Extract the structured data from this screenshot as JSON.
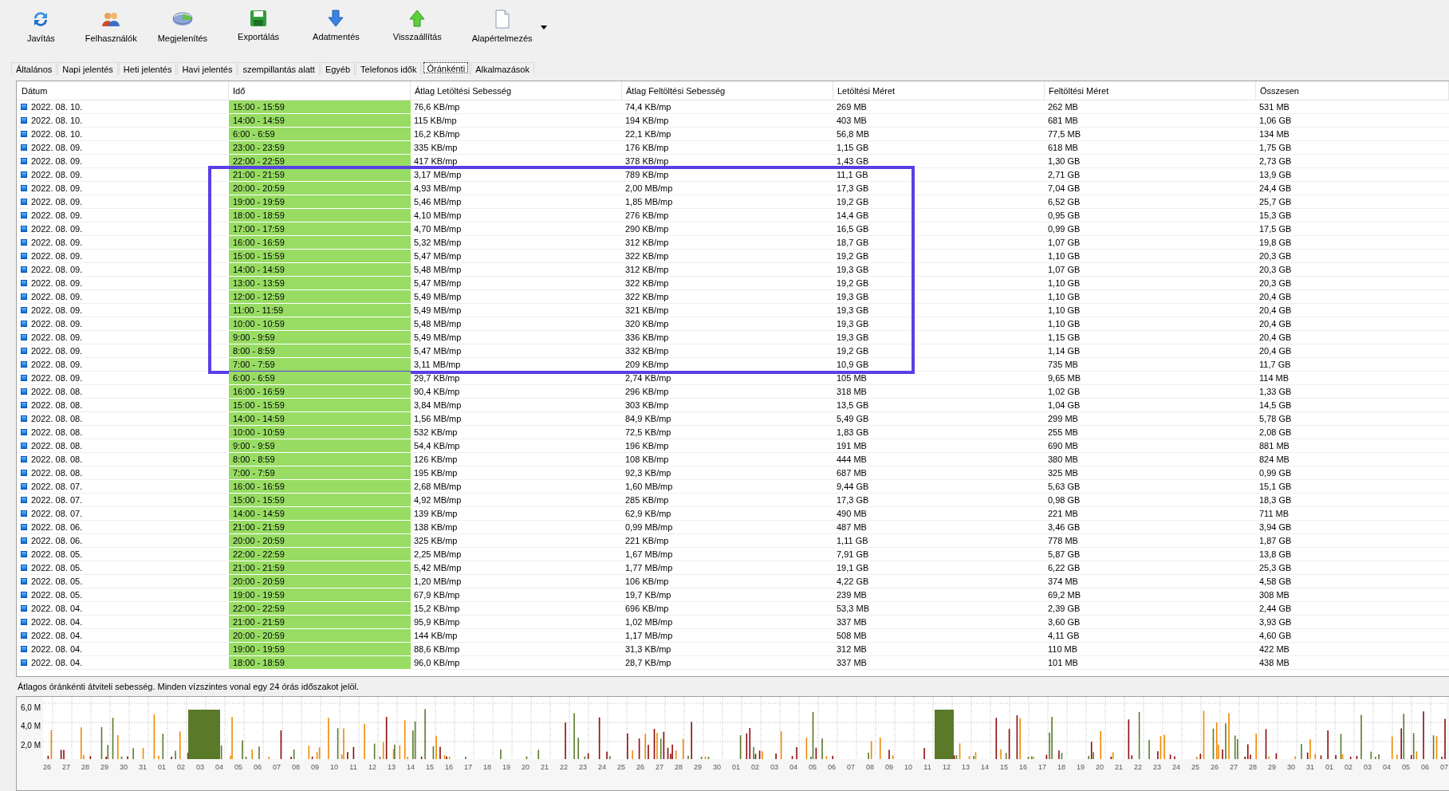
{
  "toolbar": [
    {
      "kind": "refresh",
      "label": "Javítás"
    },
    {
      "kind": "users",
      "label": "Felhasználók"
    },
    {
      "kind": "disc",
      "label": "Megjelenítés"
    },
    {
      "kind": "save",
      "label": "Exportálás"
    },
    {
      "kind": "down",
      "label": "Adatmentés"
    },
    {
      "kind": "up",
      "label": "Visszaállítás"
    },
    {
      "kind": "page",
      "label": "Alapértelmezés"
    }
  ],
  "tabs": [
    {
      "label": "Általános",
      "selected": false
    },
    {
      "label": "Napi jelentés",
      "selected": false
    },
    {
      "label": "Heti jelentés",
      "selected": false
    },
    {
      "label": "Havi jelentés",
      "selected": false
    },
    {
      "label": "szempillantás alatt",
      "selected": false
    },
    {
      "label": "Egyéb",
      "selected": false
    },
    {
      "label": "Telefonos idők",
      "selected": false
    },
    {
      "label": "Óránkénti",
      "selected": true
    },
    {
      "label": "Alkalmazások",
      "selected": false
    }
  ],
  "table": {
    "columns": [
      "Dátum",
      "Idő",
      "Átlag Letöltési Sebesség",
      "Átlag Feltöltési Sebesség",
      "Letöltési Méret",
      "Feltöltési Méret",
      "Összesen"
    ],
    "rows": [
      {
        "cells": [
          "2022. 08. 10.",
          "15:00 - 15:59",
          "76,6 KB/mp",
          "74,4 KB/mp",
          "269 MB",
          "262 MB",
          "531 MB"
        ],
        "highlighted": false
      },
      {
        "cells": [
          "2022. 08. 10.",
          "14:00 - 14:59",
          "115 KB/mp",
          "194 KB/mp",
          "403 MB",
          "681 MB",
          "1,06 GB"
        ],
        "highlighted": false
      },
      {
        "cells": [
          "2022. 08. 10.",
          "6:00 - 6:59",
          "16,2 KB/mp",
          "22,1 KB/mp",
          "56,8 MB",
          "77,5 MB",
          "134 MB"
        ],
        "highlighted": false
      },
      {
        "cells": [
          "2022. 08. 09.",
          "23:00 - 23:59",
          "335 KB/mp",
          "176 KB/mp",
          "1,15 GB",
          "618 MB",
          "1,75 GB"
        ],
        "highlighted": false
      },
      {
        "cells": [
          "2022. 08. 09.",
          "22:00 - 22:59",
          "417 KB/mp",
          "378 KB/mp",
          "1,43 GB",
          "1,30 GB",
          "2,73 GB"
        ],
        "highlighted": false
      },
      {
        "cells": [
          "2022. 08. 09.",
          "21:00 - 21:59",
          "3,17 MB/mp",
          "789 KB/mp",
          "11,1 GB",
          "2,71 GB",
          "13,9 GB"
        ],
        "highlighted": true
      },
      {
        "cells": [
          "2022. 08. 09.",
          "20:00 - 20:59",
          "4,93 MB/mp",
          "2,00 MB/mp",
          "17,3 GB",
          "7,04 GB",
          "24,4 GB"
        ],
        "highlighted": true
      },
      {
        "cells": [
          "2022. 08. 09.",
          "19:00 - 19:59",
          "5,46 MB/mp",
          "1,85 MB/mp",
          "19,2 GB",
          "6,52 GB",
          "25,7 GB"
        ],
        "highlighted": true
      },
      {
        "cells": [
          "2022. 08. 09.",
          "18:00 - 18:59",
          "4,10 MB/mp",
          "276 KB/mp",
          "14,4 GB",
          "0,95 GB",
          "15,3 GB"
        ],
        "highlighted": true
      },
      {
        "cells": [
          "2022. 08. 09.",
          "17:00 - 17:59",
          "4,70 MB/mp",
          "290 KB/mp",
          "16,5 GB",
          "0,99 GB",
          "17,5 GB"
        ],
        "highlighted": true
      },
      {
        "cells": [
          "2022. 08. 09.",
          "16:00 - 16:59",
          "5,32 MB/mp",
          "312 KB/mp",
          "18,7 GB",
          "1,07 GB",
          "19,8 GB"
        ],
        "highlighted": true
      },
      {
        "cells": [
          "2022. 08. 09.",
          "15:00 - 15:59",
          "5,47 MB/mp",
          "322 KB/mp",
          "19,2 GB",
          "1,10 GB",
          "20,3 GB"
        ],
        "highlighted": true
      },
      {
        "cells": [
          "2022. 08. 09.",
          "14:00 - 14:59",
          "5,48 MB/mp",
          "312 KB/mp",
          "19,3 GB",
          "1,07 GB",
          "20,3 GB"
        ],
        "highlighted": true
      },
      {
        "cells": [
          "2022. 08. 09.",
          "13:00 - 13:59",
          "5,47 MB/mp",
          "322 KB/mp",
          "19,2 GB",
          "1,10 GB",
          "20,3 GB"
        ],
        "highlighted": true
      },
      {
        "cells": [
          "2022. 08. 09.",
          "12:00 - 12:59",
          "5,49 MB/mp",
          "322 KB/mp",
          "19,3 GB",
          "1,10 GB",
          "20,4 GB"
        ],
        "highlighted": true
      },
      {
        "cells": [
          "2022. 08. 09.",
          "11:00 - 11:59",
          "5,49 MB/mp",
          "321 KB/mp",
          "19,3 GB",
          "1,10 GB",
          "20,4 GB"
        ],
        "highlighted": true
      },
      {
        "cells": [
          "2022. 08. 09.",
          "10:00 - 10:59",
          "5,48 MB/mp",
          "320 KB/mp",
          "19,3 GB",
          "1,10 GB",
          "20,4 GB"
        ],
        "highlighted": true
      },
      {
        "cells": [
          "2022. 08. 09.",
          "9:00 - 9:59",
          "5,49 MB/mp",
          "336 KB/mp",
          "19,3 GB",
          "1,15 GB",
          "20,4 GB"
        ],
        "highlighted": true
      },
      {
        "cells": [
          "2022. 08. 09.",
          "8:00 - 8:59",
          "5,47 MB/mp",
          "332 KB/mp",
          "19,2 GB",
          "1,14 GB",
          "20,4 GB"
        ],
        "highlighted": true
      },
      {
        "cells": [
          "2022. 08. 09.",
          "7:00 - 7:59",
          "3,11 MB/mp",
          "209 KB/mp",
          "10,9 GB",
          "735 MB",
          "11,7 GB"
        ],
        "highlighted": true
      },
      {
        "cells": [
          "2022. 08. 09.",
          "6:00 - 6:59",
          "29,7 KB/mp",
          "2,74 KB/mp",
          "105 MB",
          "9,65 MB",
          "114 MB"
        ],
        "highlighted": false
      },
      {
        "cells": [
          "2022. 08. 08.",
          "16:00 - 16:59",
          "90,4 KB/mp",
          "296 KB/mp",
          "318 MB",
          "1,02 GB",
          "1,33 GB"
        ],
        "highlighted": false
      },
      {
        "cells": [
          "2022. 08. 08.",
          "15:00 - 15:59",
          "3,84 MB/mp",
          "303 KB/mp",
          "13,5 GB",
          "1,04 GB",
          "14,5 GB"
        ],
        "highlighted": false
      },
      {
        "cells": [
          "2022. 08. 08.",
          "14:00 - 14:59",
          "1,56 MB/mp",
          "84,9 KB/mp",
          "5,49 GB",
          "299 MB",
          "5,78 GB"
        ],
        "highlighted": false
      },
      {
        "cells": [
          "2022. 08. 08.",
          "10:00 - 10:59",
          "532 KB/mp",
          "72,5 KB/mp",
          "1,83 GB",
          "255 MB",
          "2,08 GB"
        ],
        "highlighted": false
      },
      {
        "cells": [
          "2022. 08. 08.",
          "9:00 - 9:59",
          "54,4 KB/mp",
          "196 KB/mp",
          "191 MB",
          "690 MB",
          "881 MB"
        ],
        "highlighted": false
      },
      {
        "cells": [
          "2022. 08. 08.",
          "8:00 - 8:59",
          "126 KB/mp",
          "108 KB/mp",
          "444 MB",
          "380 MB",
          "824 MB"
        ],
        "highlighted": false
      },
      {
        "cells": [
          "2022. 08. 08.",
          "7:00 - 7:59",
          "195 KB/mp",
          "92,3 KB/mp",
          "687 MB",
          "325 MB",
          "0,99 GB"
        ],
        "highlighted": false
      },
      {
        "cells": [
          "2022. 08. 07.",
          "16:00 - 16:59",
          "2,68 MB/mp",
          "1,60 MB/mp",
          "9,44 GB",
          "5,63 GB",
          "15,1 GB"
        ],
        "highlighted": false
      },
      {
        "cells": [
          "2022. 08. 07.",
          "15:00 - 15:59",
          "4,92 MB/mp",
          "285 KB/mp",
          "17,3 GB",
          "0,98 GB",
          "18,3 GB"
        ],
        "highlighted": false
      },
      {
        "cells": [
          "2022. 08. 07.",
          "14:00 - 14:59",
          "139 KB/mp",
          "62,9 KB/mp",
          "490 MB",
          "221 MB",
          "711 MB"
        ],
        "highlighted": false
      },
      {
        "cells": [
          "2022. 08. 06.",
          "21:00 - 21:59",
          "138 KB/mp",
          "0,99 MB/mp",
          "487 MB",
          "3,46 GB",
          "3,94 GB"
        ],
        "highlighted": false
      },
      {
        "cells": [
          "2022. 08. 06.",
          "20:00 - 20:59",
          "325 KB/mp",
          "221 KB/mp",
          "1,11 GB",
          "778 MB",
          "1,87 GB"
        ],
        "highlighted": false
      },
      {
        "cells": [
          "2022. 08. 05.",
          "22:00 - 22:59",
          "2,25 MB/mp",
          "1,67 MB/mp",
          "7,91 GB",
          "5,87 GB",
          "13,8 GB"
        ],
        "highlighted": false
      },
      {
        "cells": [
          "2022. 08. 05.",
          "21:00 - 21:59",
          "5,42 MB/mp",
          "1,77 MB/mp",
          "19,1 GB",
          "6,22 GB",
          "25,3 GB"
        ],
        "highlighted": false
      },
      {
        "cells": [
          "2022. 08. 05.",
          "20:00 - 20:59",
          "1,20 MB/mp",
          "106 KB/mp",
          "4,22 GB",
          "374 MB",
          "4,58 GB"
        ],
        "highlighted": false
      },
      {
        "cells": [
          "2022. 08. 05.",
          "19:00 - 19:59",
          "67,9 KB/mp",
          "19,7 KB/mp",
          "239 MB",
          "69,2 MB",
          "308 MB"
        ],
        "highlighted": false
      },
      {
        "cells": [
          "2022. 08. 04.",
          "22:00 - 22:59",
          "15,2 KB/mp",
          "696 KB/mp",
          "53,3 MB",
          "2,39 GB",
          "2,44 GB"
        ],
        "highlighted": false
      },
      {
        "cells": [
          "2022. 08. 04.",
          "21:00 - 21:59",
          "95,9 KB/mp",
          "1,02 MB/mp",
          "337 MB",
          "3,60 GB",
          "3,93 GB"
        ],
        "highlighted": false
      },
      {
        "cells": [
          "2022. 08. 04.",
          "20:00 - 20:59",
          "144 KB/mp",
          "1,17 MB/mp",
          "508 MB",
          "4,11 GB",
          "4,60 GB"
        ],
        "highlighted": false
      },
      {
        "cells": [
          "2022. 08. 04.",
          "19:00 - 19:59",
          "88,6 KB/mp",
          "31,3 KB/mp",
          "312 MB",
          "110 MB",
          "422 MB"
        ],
        "highlighted": false
      },
      {
        "cells": [
          "2022. 08. 04.",
          "18:00 - 18:59",
          "96,0 KB/mp",
          "28,7 KB/mp",
          "337 MB",
          "101 MB",
          "438 MB"
        ],
        "highlighted": false
      }
    ]
  },
  "chart": {
    "caption": "Átlagos óránkénti átviteli sebesség. Minden vízszintes vonal egy 24 órás időszakot jelöl.",
    "y_labels": [
      "6,0 M",
      "4,0 M",
      "2,0 M"
    ],
    "x_labels": [
      "26",
      "27",
      "28",
      "29",
      "30",
      "31",
      "01",
      "02",
      "03",
      "04",
      "05",
      "06",
      "07",
      "08",
      "09",
      "10",
      "11",
      "12",
      "13",
      "14",
      "15",
      "16",
      "17",
      "18",
      "19",
      "20",
      "21",
      "22",
      "23",
      "24",
      "25",
      "26",
      "27",
      "28",
      "29",
      "30",
      "01",
      "02",
      "03",
      "04",
      "05",
      "06",
      "07",
      "08",
      "09",
      "10",
      "11",
      "12",
      "13",
      "14",
      "15",
      "16",
      "17",
      "18",
      "19",
      "20",
      "21",
      "22",
      "23",
      "24",
      "25",
      "26",
      "27",
      "28",
      "29",
      "30",
      "31",
      "01",
      "02",
      "03",
      "04",
      "05",
      "06",
      "07"
    ]
  }
}
